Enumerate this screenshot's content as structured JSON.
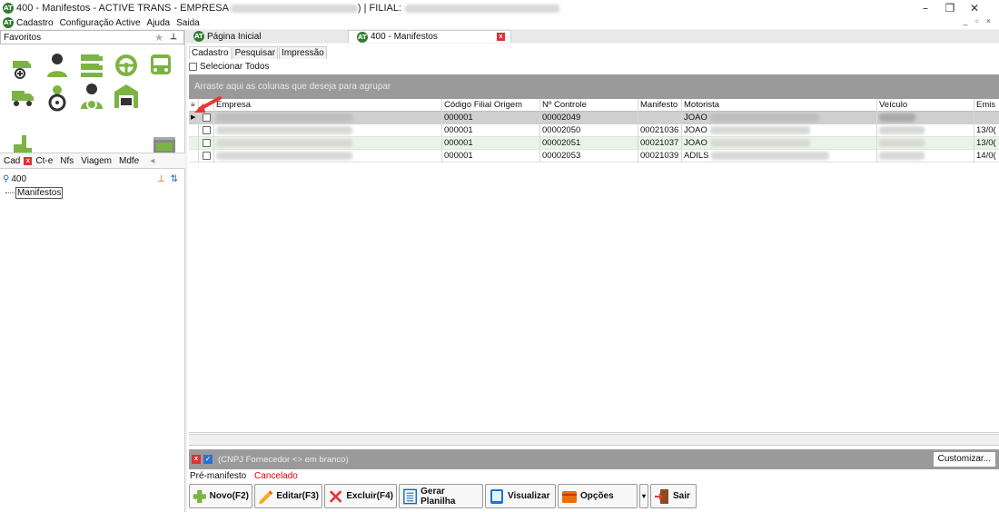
{
  "window": {
    "title_prefix": "400 - Manifestos - ACTIVE TRANS - EMPRESA",
    "title_mid": ") | FILIAL:",
    "controls": [
      "–",
      "❐",
      "✕"
    ],
    "mdi_controls": "_ ▫ ×"
  },
  "menu": [
    "Cadastro",
    "Configuração Active",
    "Ajuda",
    "Saida"
  ],
  "sidebar": {
    "favorites_label": "Favoritos",
    "tabs": [
      "Cad",
      "Ct-e",
      "Nfs",
      "Viagem",
      "Mdfe"
    ],
    "search_value": "400",
    "tree_item": "Manifestos"
  },
  "doc_tabs": [
    "Página Inicial",
    "400 - Manifestos"
  ],
  "sub_tabs": [
    "Cadastro",
    "Pesquisar",
    "Impressão"
  ],
  "select_all_label": "Selecionar Todos",
  "group_hint": "Arraste aqui as colunas que deseja para agrupar",
  "grid": {
    "columns": [
      "Empresa",
      "Código Filial Origem",
      "Nº Controle",
      "Manifesto",
      "Motorista",
      "Veículo",
      "Emis"
    ],
    "rows": [
      {
        "filial": "000001",
        "controle": "00002049",
        "manifesto": "",
        "motorista": "JOAO",
        "emissao": ""
      },
      {
        "filial": "000001",
        "controle": "00002050",
        "manifesto": "00021036",
        "motorista": "JOAO",
        "emissao": "13/0("
      },
      {
        "filial": "000001",
        "controle": "00002051",
        "manifesto": "00021037",
        "motorista": "JOAO",
        "emissao": "13/0("
      },
      {
        "filial": "000001",
        "controle": "00002053",
        "manifesto": "00021039",
        "motorista": "ADILS",
        "emissao": "14/0("
      }
    ]
  },
  "filter": {
    "text": "(CNPJ Fornecedor <> em branco)",
    "customize_label": "Customizar..."
  },
  "legend": {
    "pre": "Pré-manifesto",
    "cancel": "Cancelado"
  },
  "buttons": {
    "new": "Novo(F2)",
    "edit": "Editar(F3)",
    "delete": "Excluir(F4)",
    "sheet": "Gerar Planilha",
    "view": "Visualizar",
    "options": "Opções",
    "exit": "Sair"
  },
  "colors": {
    "accent_green": "#7cb342",
    "cancel_red": "#d00000",
    "row_selected": "#cfcfcf",
    "row_alt": "#e9f5e4"
  }
}
